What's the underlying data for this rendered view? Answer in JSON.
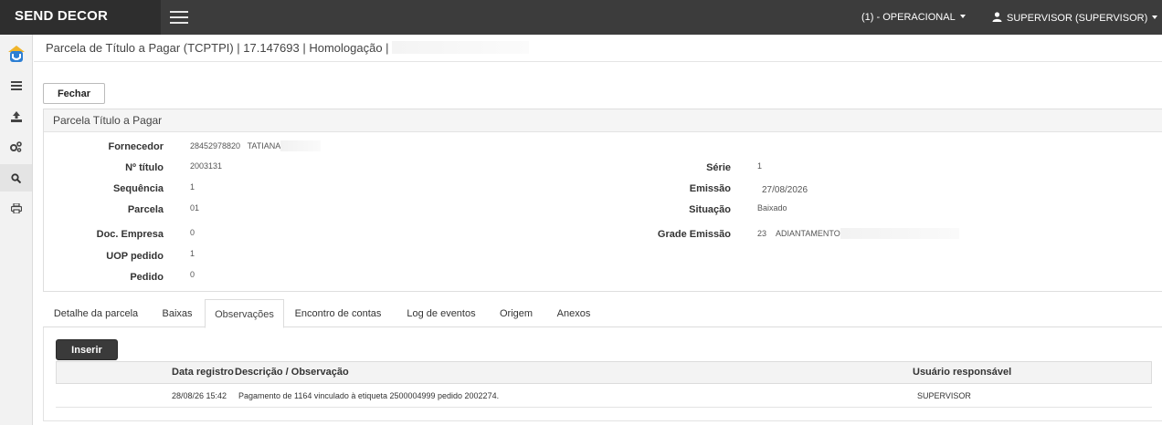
{
  "app": {
    "brand": "SEND DECOR"
  },
  "topbar": {
    "company_menu": "(1) - OPERACIONAL",
    "user_menu": "SUPERVISOR (SUPERVISOR)"
  },
  "header": {
    "title": "Parcela de Título a Pagar (TCPTPI) | 17.147693 | Homologação |"
  },
  "actions": {
    "close_label": "Fechar"
  },
  "panel": {
    "title": "Parcela Título a Pagar",
    "left_fields": [
      {
        "label": "Fornecedor",
        "value": "28452978820",
        "extra": "TATIANA"
      },
      {
        "label": "Nº título",
        "value": "2003131"
      },
      {
        "label": "Sequência",
        "value": "1"
      },
      {
        "label": "Parcela",
        "value": "01"
      },
      {
        "label": "Doc. Empresa",
        "value": "0"
      },
      {
        "label": "UOP pedido",
        "value": "1"
      },
      {
        "label": "Pedido",
        "value": "0"
      }
    ],
    "right_fields": [
      {
        "label": "Série",
        "value": "1"
      },
      {
        "label": "Emissão",
        "value": "27/08/2026"
      },
      {
        "label": "Situação",
        "value": "Baixado"
      },
      {
        "label": "Grade Emissão",
        "value": "23",
        "extra": "ADIANTAMENTO"
      }
    ]
  },
  "tabs": [
    {
      "label": "Detalhe da parcela"
    },
    {
      "label": "Baixas"
    },
    {
      "label": "Observações"
    },
    {
      "label": "Encontro de contas"
    },
    {
      "label": "Log de eventos"
    },
    {
      "label": "Origem"
    },
    {
      "label": "Anexos"
    }
  ],
  "observations": {
    "insert_label": "Inserir",
    "columns": [
      "Data registro",
      "Descrição / Observação",
      "Usuário responsável"
    ],
    "rows": [
      {
        "date": "28/08/26 15:42",
        "description": "Pagamento de 1164 vinculado à etiqueta 2500004999 pedido 2002274.",
        "user": "SUPERVISOR"
      }
    ]
  },
  "sidebar_icons": [
    "home-logo-icon",
    "list-icon",
    "upload-icon",
    "cogs-icon",
    "search-icon",
    "print-icon"
  ]
}
